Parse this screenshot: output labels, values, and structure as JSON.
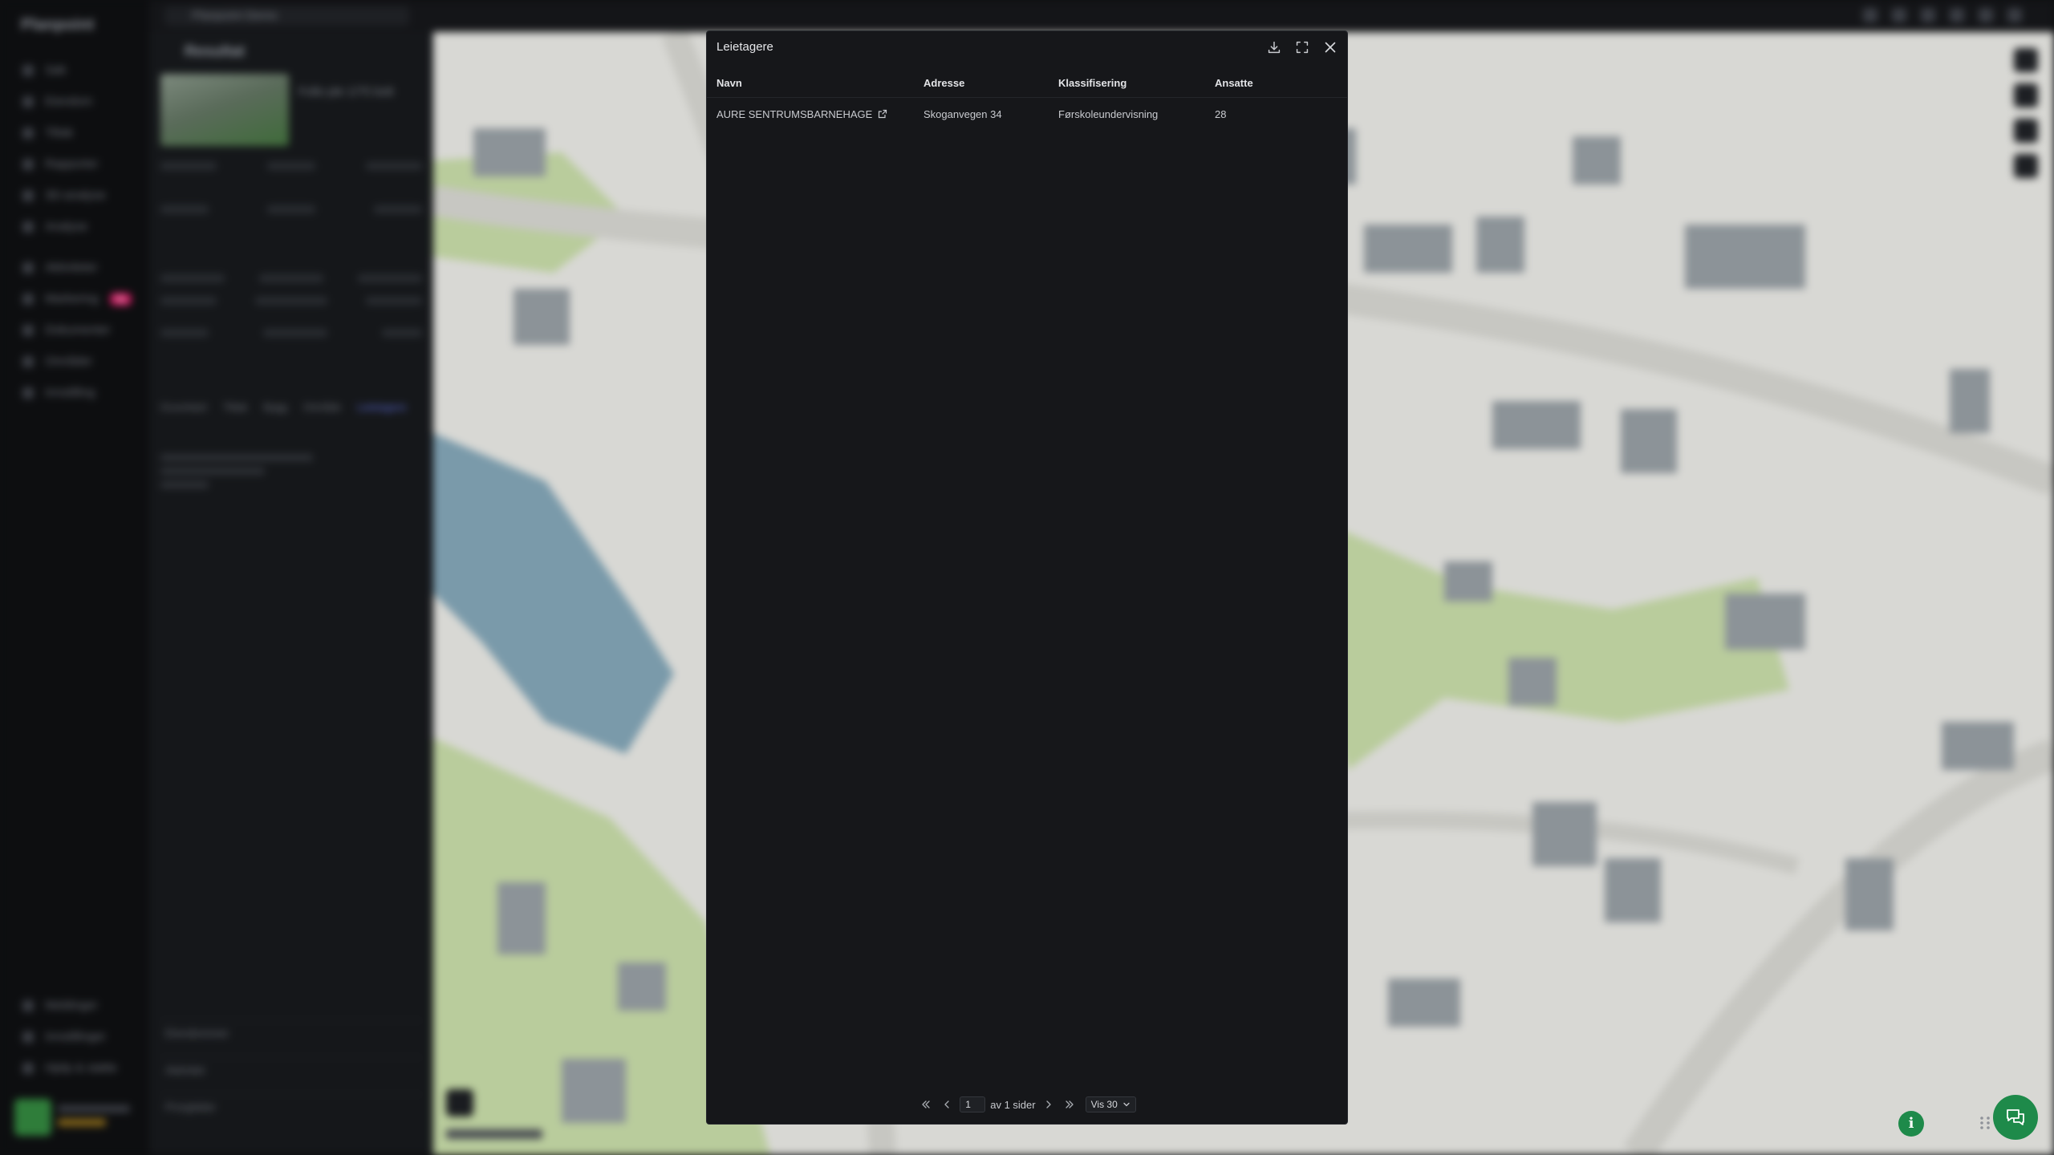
{
  "background": {
    "brand": "Planpoint",
    "tab_title": "Planpoint Demo",
    "nav_items": [
      "Søk",
      "Eiendom",
      "Tiltak",
      "Rapporter",
      "3D-analyse",
      "Analyse",
      "Aktiviteter",
      "Markering",
      "Dokumenter",
      "Områder",
      "Innstilling"
    ],
    "nav_badge": "Ny",
    "nav_bottom": [
      "Meldinger",
      "Innstillinger",
      "Hjelp & støtte"
    ],
    "panel_title": "Resultat",
    "panel_address": "Follo ple 1/75 bolt",
    "panel_tabs": [
      "Grunnkart",
      "Tiltak",
      "Bygg",
      "Område",
      "Leietagere"
    ],
    "panel_footer": [
      "Eiendommer",
      "Aktivitet",
      "Prosjekter"
    ]
  },
  "modal": {
    "title": "Leietagere",
    "download_icon": "download-icon",
    "expand_icon": "expand-icon",
    "close_icon": "close-icon",
    "columns": [
      "Navn",
      "Adresse",
      "Klassifisering",
      "Ansatte"
    ],
    "rows": [
      {
        "navn": "AURE SENTRUMSBARNEHAGE",
        "adresse": "Skoganvegen 34",
        "klassifisering": "Førskoleundervisning",
        "ansatte": "28"
      }
    ],
    "pagination": {
      "current_page": "1",
      "of_pages": "av 1 sider",
      "page_size": "Vis 30"
    }
  },
  "floating": {
    "info_label": "i",
    "chat_icon": "chat-icon"
  },
  "colors": {
    "modal_bg": "#16171a",
    "accent_green": "#1e8a4a",
    "map_base": "#d8d8d4",
    "badge_pink": "#c2185b"
  }
}
